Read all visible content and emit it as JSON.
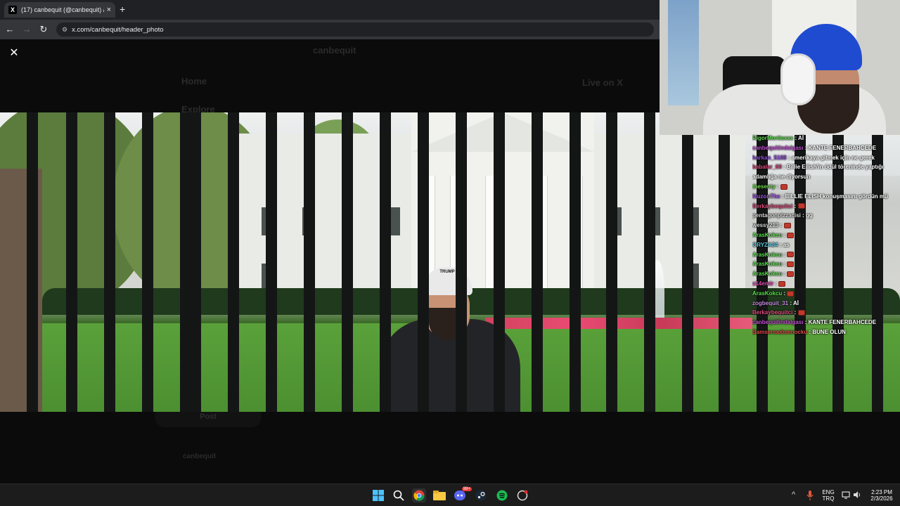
{
  "browser": {
    "tab_title": "(17) canbequit (@canbequit) / X",
    "tab_favicon": "X",
    "tab_close": "×",
    "new_tab": "+",
    "url": "x.com/canbequit/header_photo",
    "back": "←",
    "forward": "→",
    "reload": "↻",
    "site_info": "⚙"
  },
  "viewer": {
    "close_glyph": "✕",
    "background_ghost": {
      "home": "Home",
      "explore": "Explore",
      "profile_name": "canbequit",
      "live_on_x": "Live on X",
      "post_button": "Post",
      "account_name": "canbequit"
    },
    "cap_text": "TRUMP"
  },
  "stream_chat": {
    "messages": [
      {
        "user": "RigorMortisxxx",
        "color": "#5fdb4f",
        "text": ": Aİ"
      },
      {
        "user": "canbequitindalgası",
        "color": "#c54fd6",
        "text": ": KANTE FENERBAHCEDE"
      },
      {
        "user": "harkan_5108",
        "color": "#8e52d6",
        "text": ": amerikaya gitmek için ne gerek"
      },
      {
        "user": "babalar_60",
        "color": "#e0497a",
        "text": ": Billie Eilish'in ödül töreninde yaptığı"
      },
      {
        "user": "",
        "color": "#ffffff",
        "text": "adamlığa ne diyorsun"
      },
      {
        "user": "thesenty",
        "color": "#6fe04a",
        "text": ":"
      },
      {
        "user": "MuzonThe",
        "color": "#a05be0",
        "text": ": BILLIE ELISH konuşmasını gördün mü"
      },
      {
        "user": "Berkaybequitci",
        "color": "#e04a7c",
        "text": ":"
      },
      {
        "user": "pentagonpizzacisi",
        "color": "#d9d9d9",
        "text": ": gg"
      },
      {
        "user": "wessy213",
        "color": "#d9d9d9",
        "text": ":"
      },
      {
        "user": "ArasKokcu",
        "color": "#57e04a",
        "text": ":"
      },
      {
        "user": "ORYZA34",
        "color": "#5bc7e0",
        "text": ": as"
      },
      {
        "user": "ArasKokcu",
        "color": "#57e04a",
        "text": ":"
      },
      {
        "user": "ArasKokcu",
        "color": "#57e04a",
        "text": ":"
      },
      {
        "user": "ArasKokcu",
        "color": "#57e04a",
        "text": ":"
      },
      {
        "user": "x14emir",
        "color": "#e04ab5",
        "text": ":"
      },
      {
        "user": "ArasKokcu",
        "color": "#57e04a",
        "text": ":"
      },
      {
        "user": "zogbequit_31",
        "color": "#c38ae0",
        "text": ": Aİ"
      },
      {
        "user": "Berkaybequitci",
        "color": "#e04a7c",
        "text": ":"
      },
      {
        "user": "canbequitindalgası",
        "color": "#c54fd6",
        "text": ": KANTE FENERBAHCEDE"
      },
      {
        "user": "Bamsenoobsenocku",
        "color": "#e04a4a",
        "text": ": BUNE OLUN"
      }
    ]
  },
  "taskbar": {
    "language_top": "ENG",
    "language_bottom": "TRQ",
    "time": "2:23 PM",
    "date": "2/3/2026",
    "chevron": "^",
    "discord_badge": "99+"
  }
}
